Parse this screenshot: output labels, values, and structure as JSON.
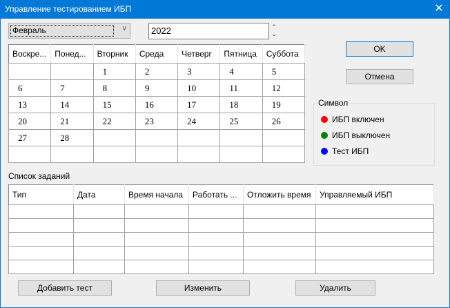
{
  "window": {
    "title": "Управление тестированием ИБП",
    "close": "✕"
  },
  "month": {
    "value": "Февраль"
  },
  "year": {
    "value": "2022"
  },
  "calendar": {
    "headers": [
      "Воскре...",
      "Понед...",
      "Вторник",
      "Среда",
      "Четверг",
      "Пятница",
      "Суббота"
    ],
    "rows": [
      [
        "",
        "",
        "1",
        "2",
        "3",
        "4",
        "5"
      ],
      [
        "6",
        "7",
        "8",
        "9",
        "10",
        "11",
        "12"
      ],
      [
        "13",
        "14",
        "15",
        "16",
        "17",
        "18",
        "19"
      ],
      [
        "20",
        "21",
        "22",
        "23",
        "24",
        "25",
        "26"
      ],
      [
        "27",
        "28",
        "",
        "",
        "",
        "",
        ""
      ],
      [
        "",
        "",
        "",
        "",
        "",
        "",
        ""
      ]
    ]
  },
  "buttons": {
    "ok": "OK",
    "cancel": "Отмена",
    "add": "Добавить тест",
    "edit": "Изменить",
    "delete": "Удалить"
  },
  "legend": {
    "title": "Символ",
    "items": [
      {
        "label": "ИБП включен",
        "color": "#ff0000"
      },
      {
        "label": "ИБП выключен",
        "color": "#008000"
      },
      {
        "label": "Тест ИБП",
        "color": "#0000ff"
      }
    ]
  },
  "tasks": {
    "title": "Список заданий",
    "headers": [
      "Тип",
      "Дата",
      "Время начала",
      "Работать ...",
      "Отложить время",
      "Управляемый ИБП"
    ]
  }
}
